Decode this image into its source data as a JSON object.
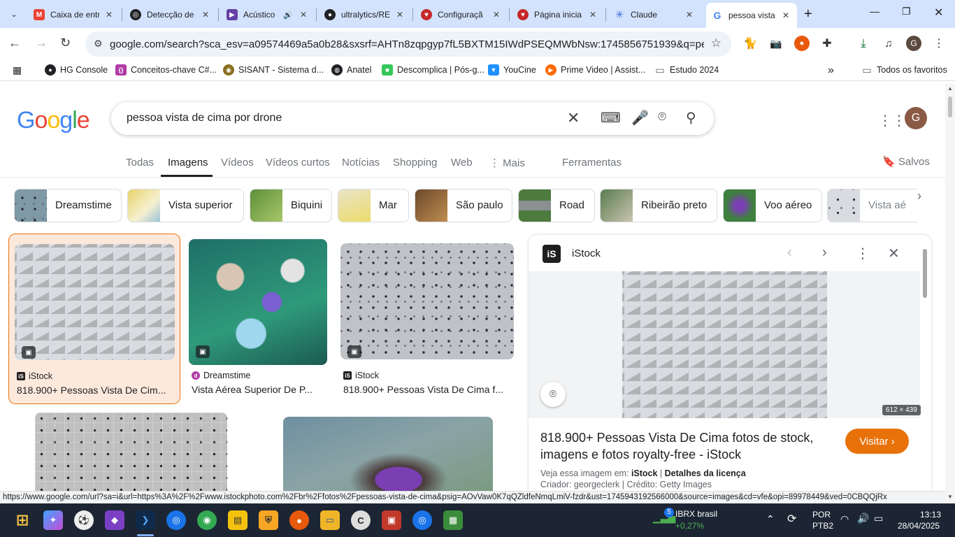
{
  "browser": {
    "tabs": [
      {
        "title": "Caixa de entrada",
        "favicon": "gmail-icon",
        "color": "#ea4335"
      },
      {
        "title": "Detecção de",
        "favicon": "openai-icon",
        "color": "#202124"
      },
      {
        "title": "Acústico",
        "favicon": "twitch-icon",
        "color": "#6441a5"
      },
      {
        "title": "ultralytics/RE",
        "favicon": "github-icon",
        "color": "#202124"
      },
      {
        "title": "Configuraçã",
        "favicon": "sisant-icon",
        "color": "#c62828"
      },
      {
        "title": "Página inicia",
        "favicon": "sisant-icon",
        "color": "#c62828"
      },
      {
        "title": "Claude",
        "favicon": "claude-icon",
        "color": "#3b6fd6"
      },
      {
        "title": "pessoa vista",
        "favicon": "google-icon",
        "color": "#4285f4"
      }
    ],
    "url": "google.com/search?sca_esv=a09574469a5a0b28&sxsrf=AHTn8zqpgyp7fL5BXTM15IWdPSEQMWbNsw:1745856751939&q=pessoa+vist...",
    "bookmarks": [
      {
        "label": "HG Console",
        "icon": "github-icon",
        "color": "#202124"
      },
      {
        "label": "Conceitos-chave C#...",
        "icon": "csharp-icon",
        "color": "#b03aa6"
      },
      {
        "label": "SISANT - Sistema d...",
        "icon": "sisant-icon",
        "color": "#8a6d1e"
      },
      {
        "label": "Anatel",
        "icon": "globe-icon",
        "color": "#202124"
      },
      {
        "label": "Descomplica | Pós-g...",
        "icon": "descomplica-icon",
        "color": "#34c759"
      },
      {
        "label": "YouCine",
        "icon": "youcine-icon",
        "color": "#1e90ff"
      },
      {
        "label": "Prime Video | Assist...",
        "icon": "prime-icon",
        "color": "#ff6a00"
      },
      {
        "label": "Estudo 2024",
        "icon": "folder-icon",
        "color": "#5f6368"
      }
    ],
    "all_bookmarks": "Todos os favoritos",
    "profile_initial": "G"
  },
  "google": {
    "logo": "Google",
    "query": "pessoa vista de cima por drone",
    "tabs": [
      "Todas",
      "Imagens",
      "Vídeos",
      "Vídeos curtos",
      "Notícias",
      "Shopping",
      "Web",
      "Mais",
      "Ferramentas"
    ],
    "active_tab": "Imagens",
    "saved": "Salvos",
    "chips": [
      "Dreamstime",
      "Vista superior",
      "Biquini",
      "Mar",
      "São paulo",
      "Road",
      "Ribeirão preto",
      "Voo aéreo",
      "Vista aé"
    ],
    "results": [
      {
        "source": "iStock",
        "title": "818.900+ Pessoas Vista De Cim..."
      },
      {
        "source": "Dreamstime",
        "title": "Vista Aérea Superior De P..."
      },
      {
        "source": "iStock",
        "title": "818.900+ Pessoas Vista De Cima f..."
      }
    ],
    "profile_initial": "G"
  },
  "preview": {
    "source": "iStock",
    "dimensions": "612 × 439",
    "title": "818.900+ Pessoas Vista De Cima fotos de stock, imagens e fotos royalty-free - iStock",
    "visit": "Visitar",
    "seen_prefix": "Veja essa imagem em:",
    "seen_source": "iStock",
    "license": "Detalhes da licença",
    "creator": "Criador: georgeclerk | Crédito: Getty Images"
  },
  "status_url": "https://www.google.com/url?sa=i&url=https%3A%2F%2Fwww.istockphoto.com%2Fbr%2Ffotos%2Fpessoas-vista-de-cima&psig=AOvVaw0K7qQZldfeNmqLmiV-fzdr&ust=1745943192566000&source=images&cd=vfe&opi=89978449&ved=0CBQQjRx",
  "taskbar": {
    "stock_name": "IBRX brasil",
    "stock_change": "+0,27%",
    "stock_badge": "5",
    "lang": "POR",
    "layout": "PTB2",
    "time": "13:13",
    "date": "28/04/2025"
  }
}
